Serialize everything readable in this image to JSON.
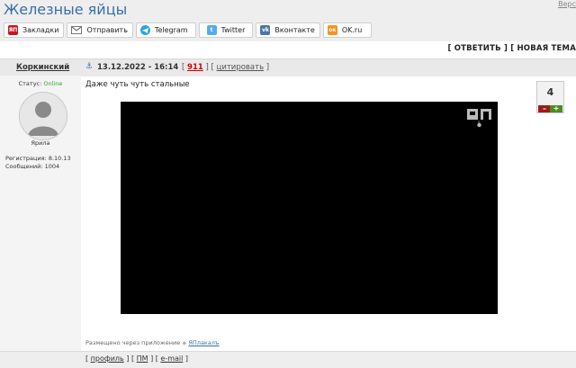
{
  "page": {
    "title": "Железные яйцы",
    "corner_link": "Верс"
  },
  "share": [
    {
      "label": "Закладки",
      "icon": "yaplakal-icon"
    },
    {
      "label": "Отправить",
      "icon": "envelope-icon"
    },
    {
      "label": "Telegram",
      "icon": "telegram-icon"
    },
    {
      "label": "Twitter",
      "icon": "twitter-icon"
    },
    {
      "label": "Вконтакте",
      "icon": "vk-icon"
    },
    {
      "label": "OK.ru",
      "icon": "ok-icon"
    }
  ],
  "topic_actions": {
    "reply": "ОТВЕТИТЬ",
    "new_topic": "НОВАЯ ТЕМА"
  },
  "post": {
    "author": "Коркинский",
    "date": "13.12.2022 - 16:14",
    "number": "911",
    "quote_label": "цитировать",
    "text": "Даже чуть чуть стальные",
    "rating": "4",
    "via_prefix": "Размещено через приложение",
    "via_app": "ЯПлакалъ"
  },
  "profile": {
    "status_label": "Статус:",
    "status_value": "Online",
    "rank": "Ярила",
    "registration": "Регистрация: 8.10.13",
    "messages": "Сообщений: 1004"
  },
  "footer": {
    "profile": "профиль",
    "pm": "ПМ",
    "email": "e-mail"
  },
  "colors": {
    "title": "#3a6fa8",
    "online": "#2fa52f",
    "post_number": "#cc0000",
    "vote_minus": "#9c1b1b",
    "vote_plus": "#4e8a23"
  }
}
